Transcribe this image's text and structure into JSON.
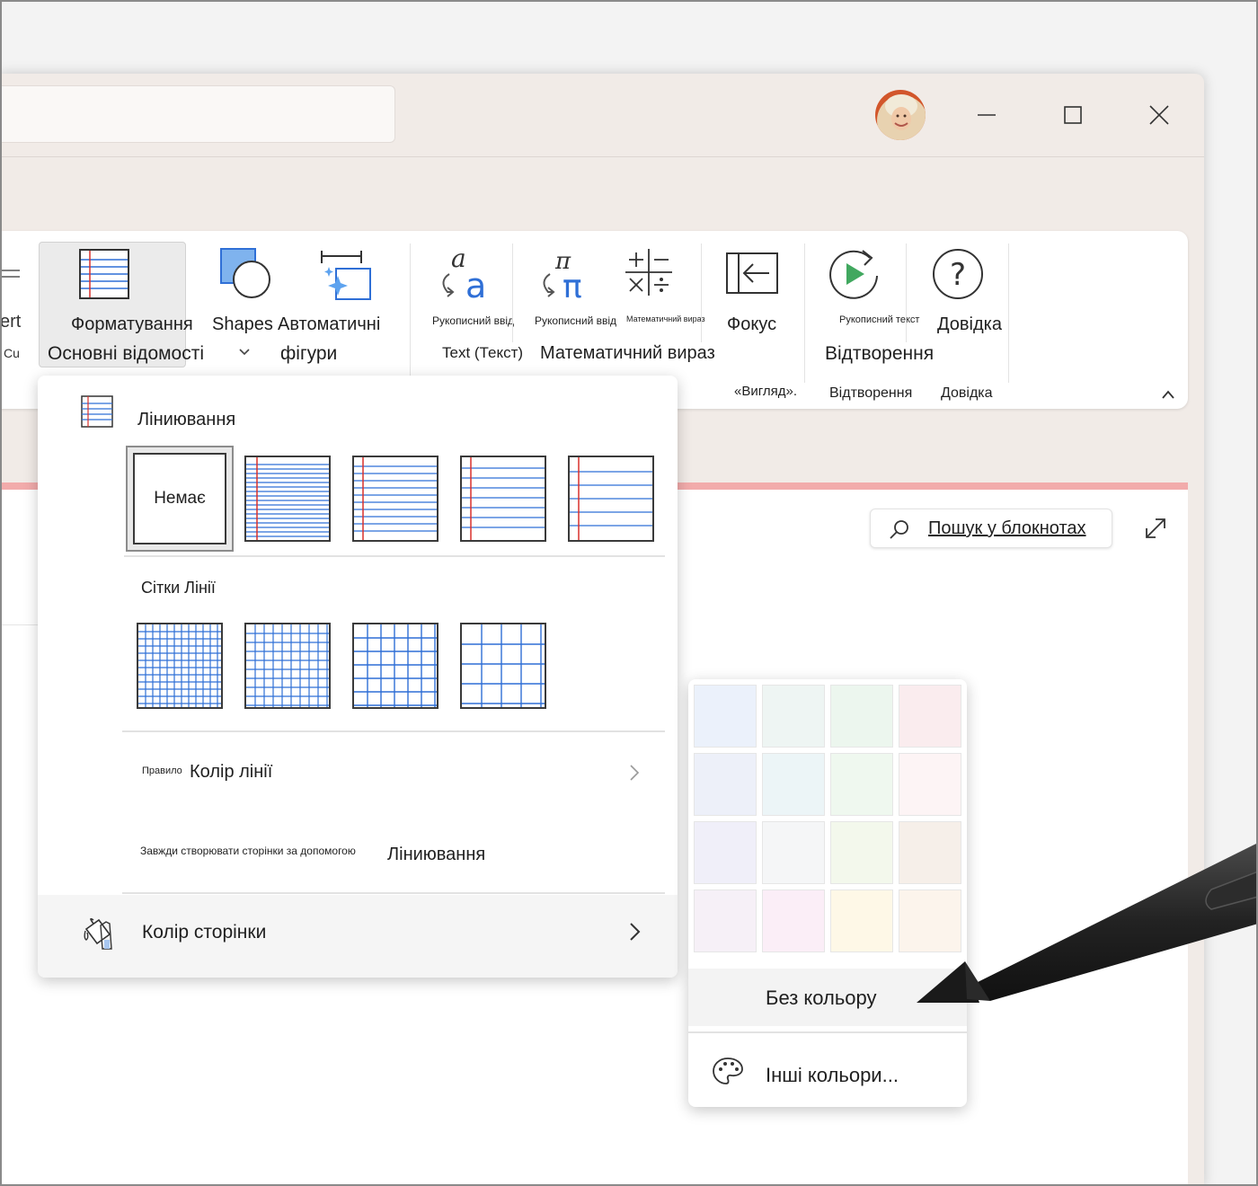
{
  "ribbon": {
    "cut_left_top": "ert",
    "cut_left_bottom": "Cu",
    "formatting": "Форматування",
    "basics": "Основні відомості",
    "shapes": "Shapes",
    "auto_top": "Автоматичні",
    "auto_bottom": "фігури",
    "ink_to_text": "Рукописний ввід",
    "ink_to_math": "Рукописний ввід",
    "math_small": "Математичний вираз",
    "focus": "Фокус",
    "text_label": "Text (Текст)",
    "math_label": "Математичний вираз",
    "replay_small": "Рукописний текст",
    "help": "Довідка",
    "replay": "Відтворення",
    "group_view": "«Вигляд».",
    "group_replay": "Відтворення",
    "group_help": "Довідка"
  },
  "search": {
    "label": "Пошук у блокнотах"
  },
  "menu": {
    "rule_lines_title": "Ліниювання",
    "none_label": "Немає",
    "grid_title": "Сітки Лінії",
    "rule_prefix": "Правило",
    "line_color": "Колір лінії",
    "always_create": "Завжди створювати сторінки за допомогою",
    "always_rule": "Ліниювання",
    "page_color": "Колір сторінки"
  },
  "colors": {
    "swatches": [
      "#ebf1fb",
      "#eef5f3",
      "#ecf6ee",
      "#faecee",
      "#edf0f9",
      "#ecf5f7",
      "#eff8ef",
      "#fdf4f5",
      "#f0eff9",
      "#f5f6f7",
      "#f3f8ec",
      "#f6efe9",
      "#f6f0f7",
      "#fbeef7",
      "#fef8e7",
      "#fcf4ec"
    ],
    "no_color": "Без кольору",
    "more_colors": "Інші кольори..."
  }
}
